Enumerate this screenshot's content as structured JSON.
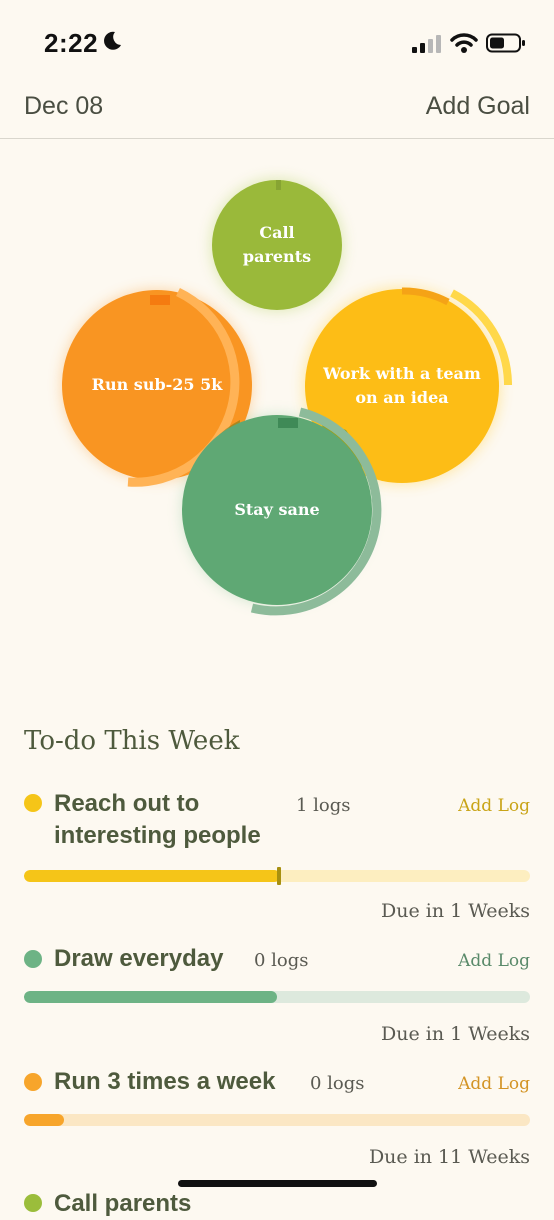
{
  "status_bar": {
    "time": "2:22"
  },
  "header": {
    "date": "Dec 08",
    "add_goal": "Add Goal"
  },
  "circles": {
    "call_parents": "Call parents",
    "run": "Run sub-25 5k",
    "work": "Work with a team on an idea",
    "sane": "Stay sane"
  },
  "todo": {
    "title": "To-do This Week",
    "items": [
      {
        "name": "Reach out to interesting people",
        "logs": "1 logs",
        "add_log": "Add Log",
        "due": "Due in 1 Weeks",
        "progress": 0.5,
        "color": "#f5c518",
        "track": "#fdeec0",
        "addlog_color": "#c9a418"
      },
      {
        "name": "Draw everyday",
        "logs": "0 logs",
        "add_log": "Add Log",
        "due": "Due in 1 Weeks",
        "progress": 0.5,
        "color": "#6db385",
        "track": "#dde9dd",
        "addlog_color": "#5a8a6a"
      },
      {
        "name": "Run 3 times a week",
        "logs": "0 logs",
        "add_log": "Add Log",
        "due": "Due in 11 Weeks",
        "progress": 0.08,
        "color": "#f7a52b",
        "track": "#fbe7c4",
        "addlog_color": "#d39425"
      },
      {
        "name": "Call parents",
        "color": "#9bbd3b"
      }
    ]
  }
}
